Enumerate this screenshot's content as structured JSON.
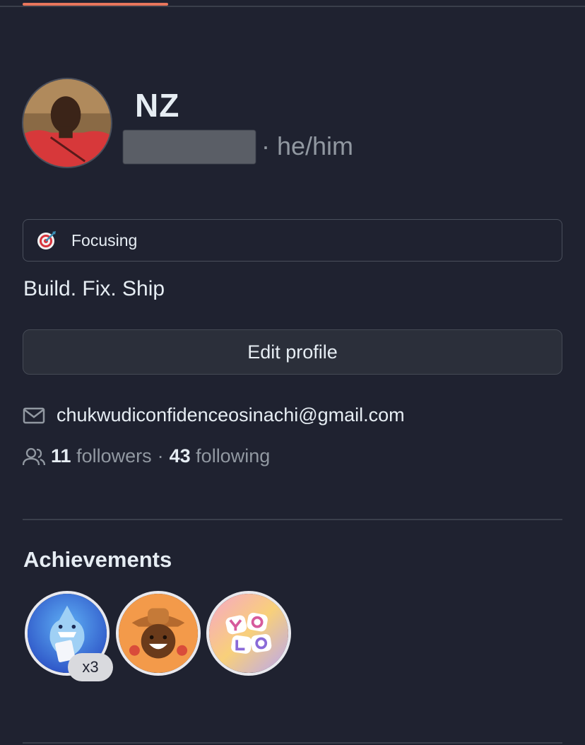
{
  "profile": {
    "display_name": "NZ",
    "pronouns": "· he/him",
    "bio": "Build. Fix. Ship"
  },
  "status": {
    "emoji": "direct-hit-target-icon",
    "text": "Focusing"
  },
  "actions": {
    "edit_profile_label": "Edit profile"
  },
  "contact": {
    "email": "chukwudiconfidenceosinachi@gmail.com"
  },
  "social": {
    "followers_count": "11",
    "followers_label": "followers",
    "separator": "·",
    "following_count": "43",
    "following_label": "following"
  },
  "achievements": {
    "title": "Achievements",
    "badges": [
      {
        "icon": "pull-shark-badge-icon",
        "count_label": "x3"
      },
      {
        "icon": "starstruck-cowboy-badge-icon"
      },
      {
        "icon": "yolo-badge-icon"
      }
    ]
  },
  "colors": {
    "accent_underline": "#e8765c",
    "background": "#1f2230",
    "muted_text": "#9198a1"
  }
}
